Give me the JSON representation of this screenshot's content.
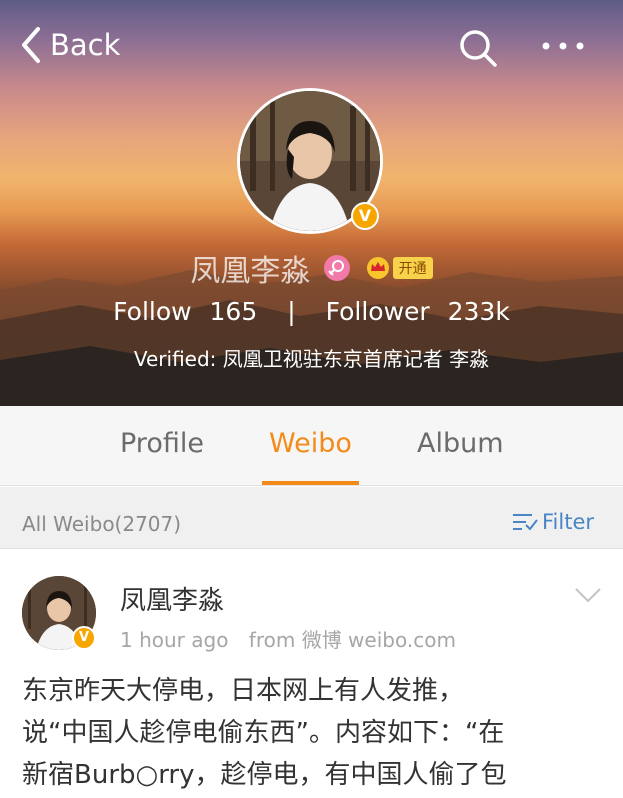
{
  "nav": {
    "back_label": "Back"
  },
  "profile": {
    "name": "凤凰李淼",
    "vip_open_label": "开通",
    "follow_label": "Follow",
    "follow_count": "165",
    "separator": "|",
    "follower_label": "Follower",
    "follower_count": "233k",
    "verified_text": "Verified: 凤凰卫视驻东京首席记者 李淼"
  },
  "tabs": [
    {
      "label": "Profile",
      "active": false
    },
    {
      "label": "Weibo",
      "active": true
    },
    {
      "label": "Album",
      "active": false
    }
  ],
  "filter_bar": {
    "all_weibo": "All Weibo(2707)",
    "filter_label": "Filter"
  },
  "post": {
    "author": "凤凰李淼",
    "time": "1 hour ago",
    "source": "from 微博 weibo.com",
    "text_lines": [
      "东京昨天大停电，日本网上有人发推，",
      "说“中国人趁停电偷东西”。内容如下：“在",
      "新宿Burb○rry，趁停电，有中国人偷了包"
    ]
  },
  "colors": {
    "accent": "#f38a1a",
    "link": "#4a86c5",
    "verified_badge": "#f7a600",
    "gender_female": "#f27aa9"
  },
  "icons": {
    "back": "chevron-left-icon",
    "search": "search-icon",
    "more": "more-dots-icon",
    "verified": "verified-v-icon",
    "gender": "female-gender-icon",
    "vip": "vip-crown-icon",
    "filter": "filter-icon",
    "post_menu": "chevron-down-icon"
  }
}
